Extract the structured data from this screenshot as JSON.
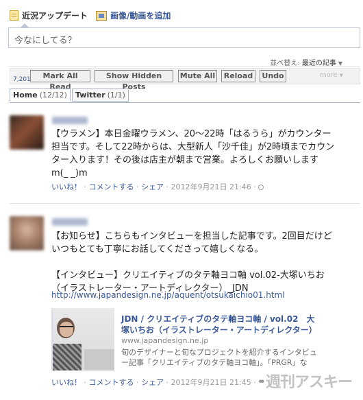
{
  "composer": {
    "tabs": [
      {
        "label": "近況アップデート",
        "icon": "status-icon"
      },
      {
        "label": "画像/動画を追加",
        "icon": "photo-icon"
      }
    ],
    "placeholder": "今なにしてる？"
  },
  "sort": {
    "label": "並べ替え:",
    "value": "最近の記事"
  },
  "toolbar": {
    "counter": "7,201",
    "buttons": [
      "Mark All Read",
      "Show Hidden Posts",
      "Mute All",
      "Reload",
      "Undo"
    ],
    "more": "more"
  },
  "filter_tabs": [
    {
      "label": "Home",
      "count": "(12/12)"
    },
    {
      "label": "Twitter",
      "count": "(1/1)"
    }
  ],
  "posts": [
    {
      "text": "【ウラメン】本日金曜ウラメン、20～22時「はるうら」がカウンター\n担当です。そして22時からは、大型新人「沙千佳」が2時頃までカウン\nター入ります！その後は店主が朝まで営業。よろしくお願いします\nm(_ _)m",
      "actions": [
        "いいね！",
        "コメントする",
        "シェア"
      ],
      "timestamp": "2012年9月21日 21:46"
    },
    {
      "text": "【お知らせ】こちらもインタビューを担当した記事です。2回目だけど\nいつもとても丁寧にお話してくださって嬉しくなる。\n\n【インタビュー】クリエイティブのタテ軸ヨコ軸 vol.02-大塚いちお\n（イラストレーター・アートディレクター）_JDN",
      "link_url": "http://www.japandesign.ne.jp/aquent/otsukaichio01.html",
      "attachment": {
        "title": "JDN / クリエイティブのタテ軸ヨコ軸 / vol.02　大塚いちお（イラストレーター・アートディレクター）",
        "domain": "www.japandesign.ne.jp",
        "description": "旬のデザイナーと旬なプロジェクトを紹介するインタビュー記事「クリエイティブのタテ軸ヨコ軸」。「PRGR」な"
      },
      "actions": [
        "いいね！",
        "コメントする",
        "シェア"
      ],
      "timestamp": "2012年9月21日 21:45"
    }
  ],
  "watermark": "週刊アスキー"
}
